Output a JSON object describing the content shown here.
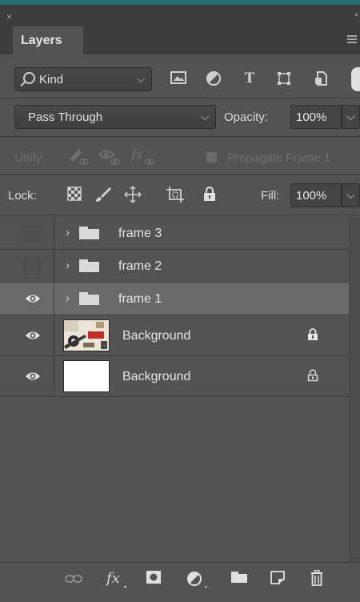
{
  "panel": {
    "tab_title": "Layers",
    "close_glyph": "×",
    "collapse_glyph": "‹‹"
  },
  "filter": {
    "kind_label": "Kind",
    "icons": [
      "image-filter-icon",
      "adjustment-filter-icon",
      "type-filter-icon",
      "shape-filter-icon",
      "smart-object-filter-icon"
    ]
  },
  "blend": {
    "mode": "Pass Through",
    "opacity_label": "Opacity:",
    "opacity_value": "100%"
  },
  "unify": {
    "label": "Unify:",
    "propagate_label": "Propagate Frame 1"
  },
  "lock": {
    "label": "Lock:",
    "fill_label": "Fill:",
    "fill_value": "100%"
  },
  "layers": [
    {
      "name": "frame 3",
      "type": "group",
      "visible": false,
      "selected": false
    },
    {
      "name": "frame 2",
      "type": "group",
      "visible": false,
      "selected": false
    },
    {
      "name": "frame 1",
      "type": "group",
      "visible": true,
      "selected": true
    },
    {
      "name": "Background",
      "type": "pixel",
      "visible": true,
      "thumbnail": "image",
      "locked": true
    },
    {
      "name": "Background",
      "type": "pixel",
      "visible": true,
      "thumbnail": "white",
      "locked": true
    }
  ],
  "colors": {
    "panel_bg": "#535353",
    "header_bg": "#3c3c3c",
    "selected_row": "#696969",
    "accent_bar": "#1f6f74"
  }
}
